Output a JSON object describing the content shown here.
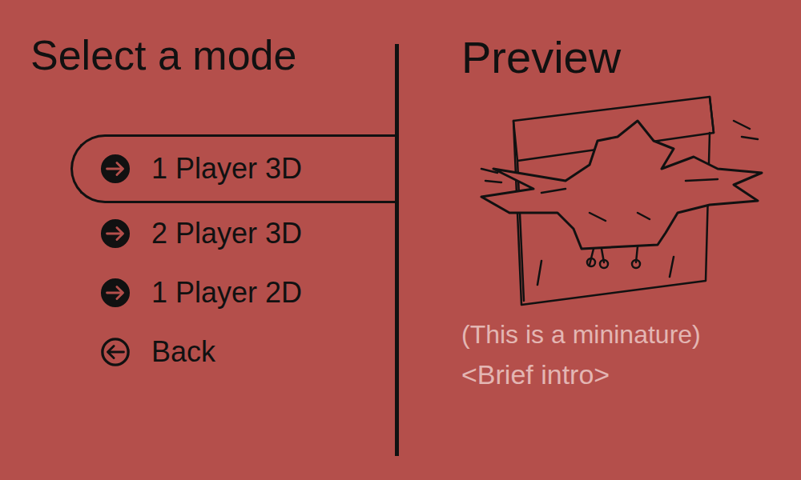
{
  "title": "Select a mode",
  "modes": [
    {
      "label": "1 Player 3D",
      "selected": true,
      "kind": "forward"
    },
    {
      "label": "2 Player 3D",
      "selected": false,
      "kind": "forward"
    },
    {
      "label": "1 Player 2D",
      "selected": false,
      "kind": "forward"
    },
    {
      "label": "Back",
      "selected": false,
      "kind": "back"
    }
  ],
  "preview": {
    "title": "Preview",
    "caption": "(This is a mininature)",
    "intro": "<Brief intro>"
  }
}
